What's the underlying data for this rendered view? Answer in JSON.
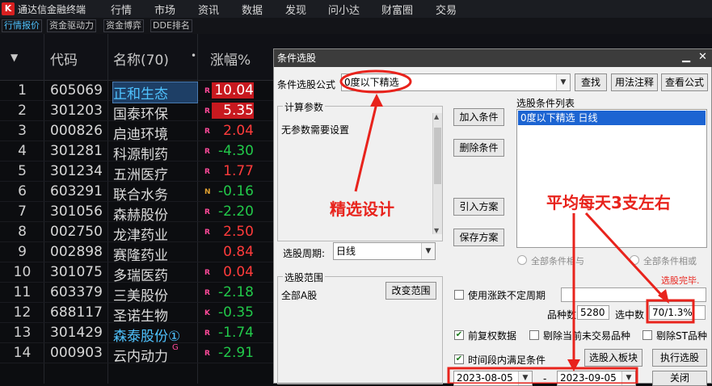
{
  "app": {
    "logo": "K",
    "title": "通达信金融终端"
  },
  "menu": [
    "行情",
    "市场",
    "资讯",
    "数据",
    "发现",
    "问小达",
    "财富圈",
    "交易"
  ],
  "tabs": [
    {
      "label": "行情报价",
      "active": true
    },
    {
      "label": "资金驱动力",
      "active": false
    },
    {
      "label": "资金博弈",
      "active": false
    },
    {
      "label": "DDE排名",
      "active": false
    }
  ],
  "table": {
    "headers": {
      "arrow": "▼",
      "code": "代码",
      "name": "名称(70)",
      "dot": "•",
      "change": "涨幅%"
    },
    "rows": [
      {
        "idx": "1",
        "code": "605069",
        "name": "正和生态",
        "tag": "R",
        "change": "10.04",
        "color": "#ffffff",
        "bg": "#c8191f",
        "name_color": "#4fc3ff",
        "selected": true
      },
      {
        "idx": "2",
        "code": "301203",
        "name": "国泰环保",
        "tag": "R",
        "change": "5.35",
        "color": "#ffffff",
        "bg": "#c8191f",
        "name_color": "#dcdcdc"
      },
      {
        "idx": "3",
        "code": "000826",
        "name": "启迪环境",
        "tag": "R",
        "change": "2.04",
        "color": "#ff3b3b",
        "bg": "",
        "name_color": "#dcdcdc"
      },
      {
        "idx": "4",
        "code": "301281",
        "name": "科源制药",
        "tag": "R",
        "change": "-4.30",
        "color": "#22c94a",
        "bg": "",
        "name_color": "#dcdcdc"
      },
      {
        "idx": "5",
        "code": "301234",
        "name": "五洲医疗",
        "tag": "R",
        "change": "1.77",
        "color": "#ff3b3b",
        "bg": "",
        "name_color": "#dcdcdc"
      },
      {
        "idx": "6",
        "code": "603291",
        "name": "联合水务",
        "tag": "N",
        "change": "-0.16",
        "color": "#22c94a",
        "bg": "",
        "name_color": "#dcdcdc"
      },
      {
        "idx": "7",
        "code": "301056",
        "name": "森赫股份",
        "tag": "R",
        "change": "-2.20",
        "color": "#22c94a",
        "bg": "",
        "name_color": "#dcdcdc"
      },
      {
        "idx": "8",
        "code": "002750",
        "name": "龙津药业",
        "tag": "R",
        "change": "2.50",
        "color": "#ff3b3b",
        "bg": "",
        "name_color": "#dcdcdc"
      },
      {
        "idx": "9",
        "code": "002898",
        "name": "赛隆药业",
        "tag": "",
        "change": "0.84",
        "color": "#ff3b3b",
        "bg": "",
        "name_color": "#dcdcdc"
      },
      {
        "idx": "10",
        "code": "301075",
        "name": "多瑞医药",
        "tag": "R",
        "change": "0.04",
        "color": "#ff3b3b",
        "bg": "",
        "name_color": "#dcdcdc"
      },
      {
        "idx": "11",
        "code": "603379",
        "name": "三美股份",
        "tag": "R",
        "change": "-2.18",
        "color": "#22c94a",
        "bg": "",
        "name_color": "#dcdcdc"
      },
      {
        "idx": "12",
        "code": "688117",
        "name": "圣诺生物",
        "tag": "K",
        "change": "-0.35",
        "color": "#22c94a",
        "bg": "",
        "name_color": "#dcdcdc"
      },
      {
        "idx": "13",
        "code": "301429",
        "name": "森泰股份①",
        "tag": "R",
        "change": "-1.74",
        "color": "#22c94a",
        "bg": "",
        "name_color": "#4fc3ff"
      },
      {
        "idx": "14",
        "code": "000903",
        "name": "云内动力",
        "tag": "R",
        "change": "-2.91",
        "color": "#22c94a",
        "bg": "",
        "name_color": "#dcdcdc",
        "sup": "G"
      }
    ]
  },
  "dialog": {
    "title": "条件选股",
    "minimize": "▁",
    "close": "✕",
    "formula_label": "条件选股公式",
    "formula_value": "0度以下精选",
    "find": "查找",
    "usage": "用法注释",
    "view_formula": "查看公式",
    "calc_params": "计算参数",
    "no_params": "无参数需要设置",
    "add_condition": "加入条件",
    "delete_condition": "删除条件",
    "condition_list_title": "选股条件列表",
    "condition_item": "0度以下精选  日线",
    "import_plan": "引入方案",
    "save_plan": "保存方案",
    "period_label": "选股周期:",
    "period_value": "日线",
    "radio_and": "全部条件相与",
    "radio_or": "全部条件相或",
    "scope_title": "选股范围",
    "scope_value": "全部A股",
    "change_scope": "改变范围",
    "done": "选股完毕.",
    "use_range": "使用涨跌不定周期",
    "count_label": "品种数",
    "count_value": "5280",
    "selected_label": "选中数",
    "selected_value": "70/1.3%",
    "prev_adjust": "前复权数据",
    "exclude_untraded": "剔除当前未交易品种",
    "exclude_st": "剔除ST品种",
    "period_satisfy": "时间段内满足条件",
    "to_block": "选股入板块",
    "execute": "执行选股",
    "date_from": "2023-08-05",
    "date_to": "2023-09-05",
    "date_sep": "-",
    "close_btn": "关闭"
  },
  "annotations": {
    "design": "精选设计",
    "avg": "平均每天3支左右"
  },
  "colors": {
    "annotation": "#e8231c"
  }
}
